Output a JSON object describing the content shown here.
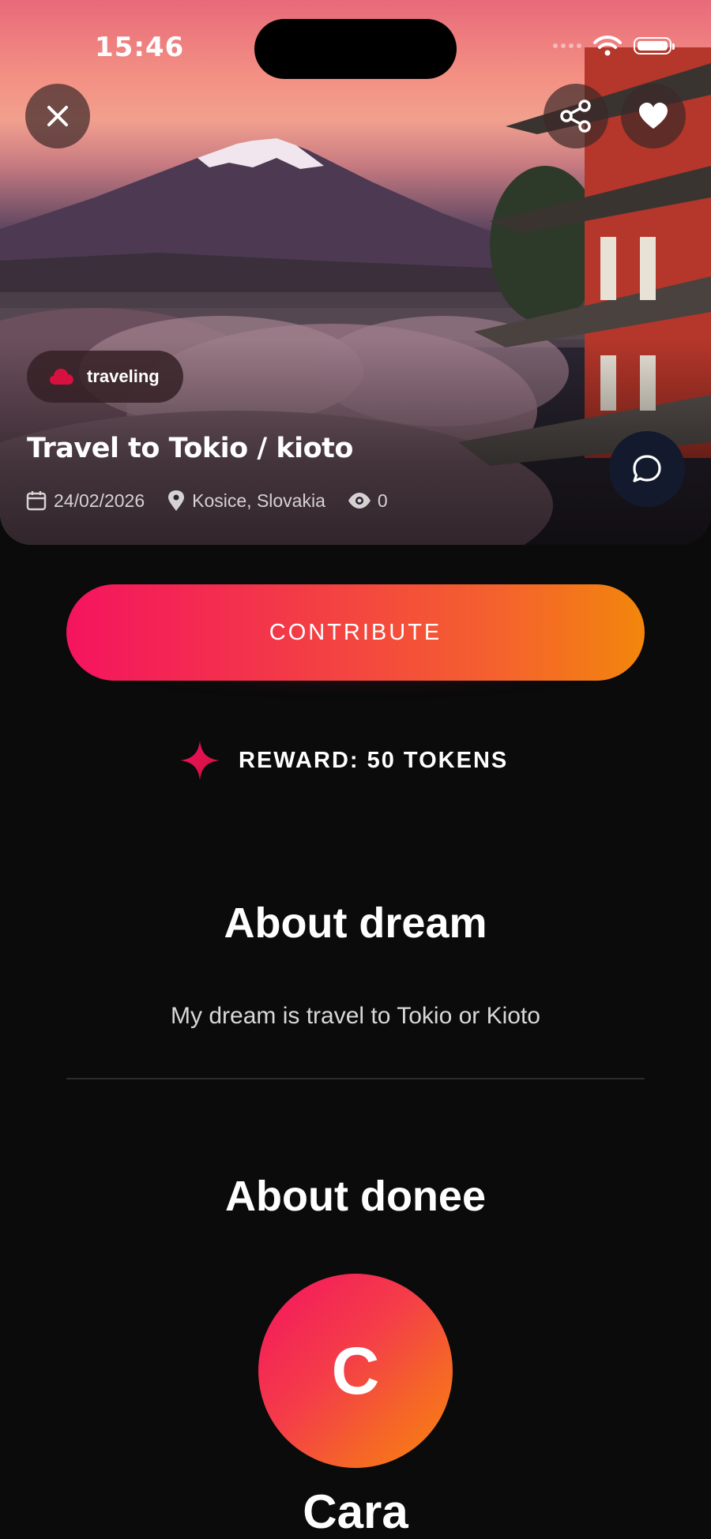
{
  "status_bar": {
    "time": "15:46"
  },
  "hero": {
    "tag_label": "traveling",
    "title": "Travel to Tokio / kioto",
    "date": "24/02/2026",
    "location": "Kosice, Slovakia",
    "views": "0"
  },
  "actions": {
    "contribute_label": "CONTRIBUTE",
    "reward_label": "REWARD: 50 TOKENS"
  },
  "about_dream": {
    "title": "About dream",
    "text": "My dream is travel to Tokio or Kioto"
  },
  "about_donee": {
    "title": "About donee",
    "avatar_initial": "C",
    "name": "Cara"
  },
  "colors": {
    "background": "#0b0b0b",
    "accent_start": "#f5145f",
    "accent_end": "#f3860c",
    "chat_button": "#131a2e"
  },
  "icons": [
    "close-icon",
    "share-icon",
    "heart-icon",
    "cloud-icon",
    "chat-icon",
    "calendar-icon",
    "location-pin-icon",
    "eye-icon",
    "sparkle-icon",
    "wifi-icon",
    "battery-icon"
  ]
}
